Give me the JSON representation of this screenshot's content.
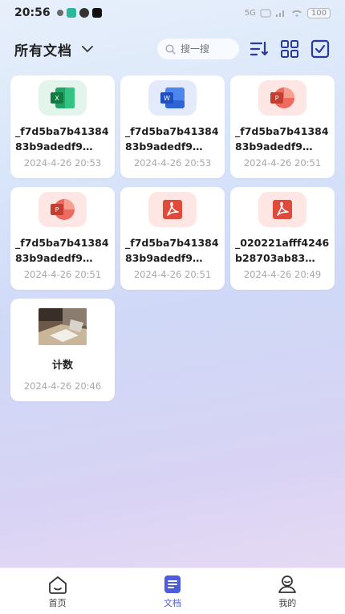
{
  "status_bar": {
    "time": "20:56",
    "battery": "100",
    "signal_label": "5G"
  },
  "header": {
    "title": "所有文档",
    "search_placeholder": "搜一搜"
  },
  "files": [
    {
      "type": "excel",
      "name": "_f7d5ba7b4138483b9adedf9…",
      "date": "2024-4-26 20:53"
    },
    {
      "type": "word",
      "name": "_f7d5ba7b4138483b9adedf9…",
      "date": "2024-4-26 20:53"
    },
    {
      "type": "ppt",
      "name": "_f7d5ba7b4138483b9adedf9…",
      "date": "2024-4-26 20:51"
    },
    {
      "type": "ppt",
      "name": "_f7d5ba7b4138483b9adedf9…",
      "date": "2024-4-26 20:51"
    },
    {
      "type": "pdf",
      "name": "_f7d5ba7b4138483b9adedf9…",
      "date": "2024-4-26 20:51"
    },
    {
      "type": "pdf",
      "name": "_020221afff4246b28703ab83…",
      "date": "2024-4-26 20:49"
    },
    {
      "type": "photo",
      "name": "计数",
      "date": "2024-4-26 20:46"
    }
  ],
  "nav": {
    "home": "首页",
    "docs": "文档",
    "mine": "我的"
  },
  "colors": {
    "accent": "#4d5bdc",
    "excel": "#21a366",
    "word": "#2f6fe0",
    "ppt": "#e8544e",
    "pdf": "#e04a3b"
  }
}
